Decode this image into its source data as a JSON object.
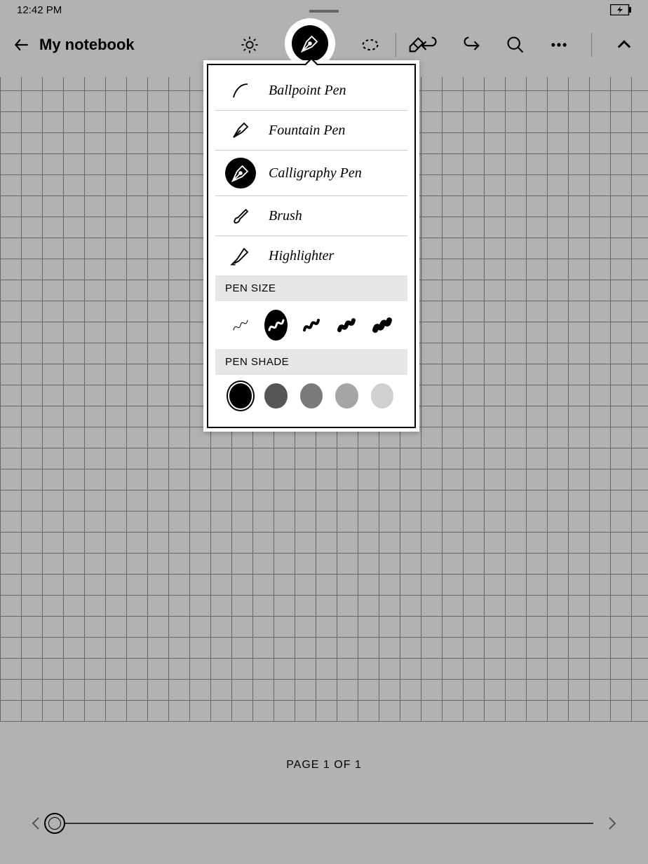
{
  "status": {
    "time": "12:42 PM"
  },
  "header": {
    "title": "My notebook"
  },
  "pens": [
    {
      "id": "ballpoint",
      "label": "Ballpoint Pen",
      "selected": false
    },
    {
      "id": "fountain",
      "label": "Fountain Pen",
      "selected": false
    },
    {
      "id": "calligraphy",
      "label": "Calligraphy Pen",
      "selected": true
    },
    {
      "id": "brush",
      "label": "Brush",
      "selected": false
    },
    {
      "id": "highlighter",
      "label": "Highlighter",
      "selected": false
    }
  ],
  "sections": {
    "size": "PEN SIZE",
    "shade": "PEN SHADE"
  },
  "sizes": [
    {
      "w": 1,
      "selected": false
    },
    {
      "w": 3,
      "selected": true
    },
    {
      "w": 4,
      "selected": false
    },
    {
      "w": 6,
      "selected": false
    },
    {
      "w": 8,
      "selected": false
    }
  ],
  "shades": [
    {
      "color": "#000000",
      "selected": true
    },
    {
      "color": "#555555",
      "selected": false
    },
    {
      "color": "#7a7a7a",
      "selected": false
    },
    {
      "color": "#a5a5a5",
      "selected": false
    },
    {
      "color": "#d0d0d0",
      "selected": false
    }
  ],
  "footer": {
    "page_text": "PAGE 1 OF 1"
  }
}
